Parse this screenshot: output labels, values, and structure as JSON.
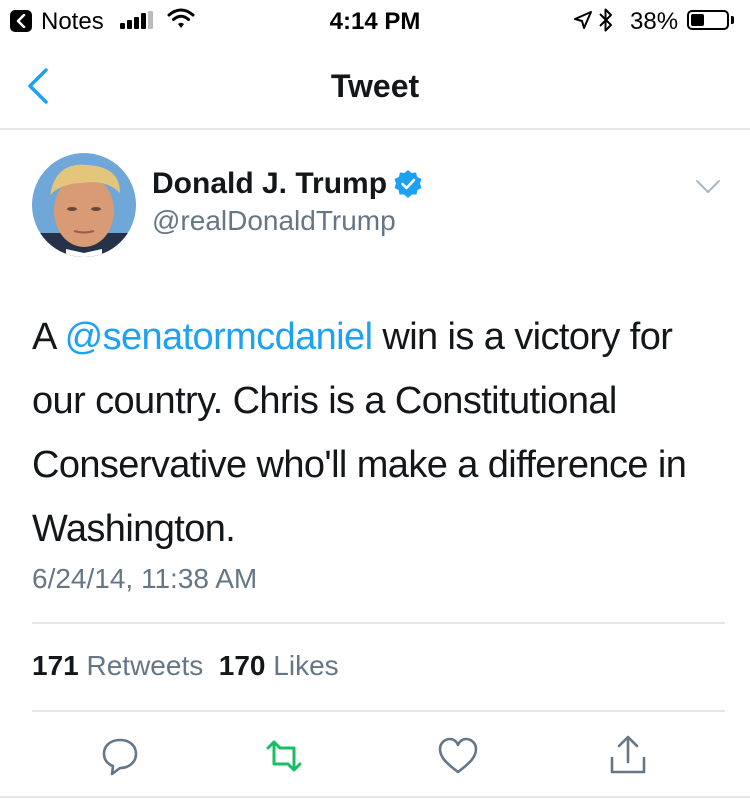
{
  "status_bar": {
    "back_app": "Notes",
    "time": "4:14 PM",
    "battery_percent": "38%",
    "battery_level": 0.38,
    "signal_bars": 4,
    "icons": [
      "back-arrow-icon",
      "signal-icon",
      "wifi-icon",
      "location-icon",
      "bluetooth-icon",
      "battery-icon"
    ]
  },
  "nav": {
    "title": "Tweet",
    "back_icon": "chevron-left-icon"
  },
  "tweet": {
    "author_name": "Donald J. Trump",
    "author_handle": "@realDonaldTrump",
    "verified": true,
    "text_prefix": "A ",
    "mention": "@senatormcdaniel",
    "text_suffix": " win is a victory for our country. Chris is a Constitutional Conservative who'll make a difference in Washington.",
    "timestamp": "6/24/14, 11:38 AM",
    "retweets_count": "171",
    "retweets_label": "Retweets",
    "likes_count": "170",
    "likes_label": "Likes"
  },
  "actions": [
    "reply-icon",
    "retweet-icon",
    "like-icon",
    "share-icon"
  ],
  "colors": {
    "accent": "#1da1f2",
    "retweet": "#17bf63",
    "secondary_text": "#657786",
    "primary_text": "#14171a",
    "divider": "#e1e8ed"
  }
}
